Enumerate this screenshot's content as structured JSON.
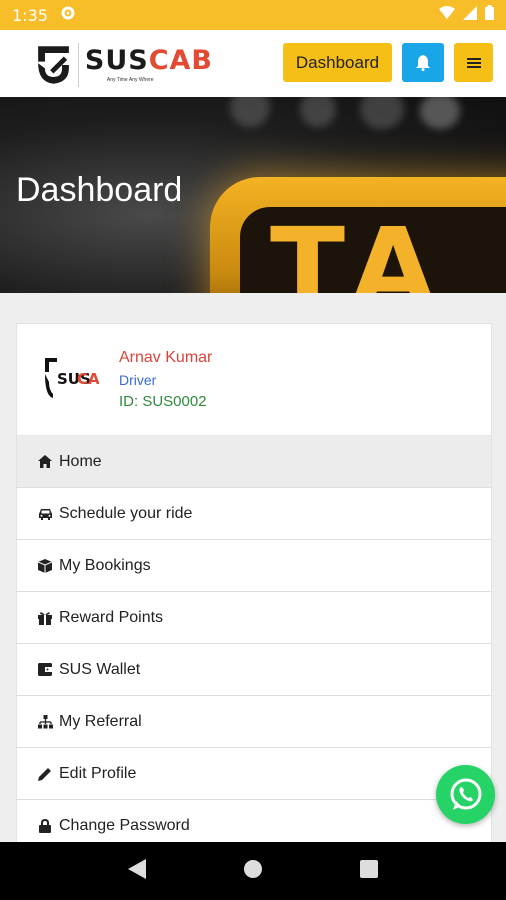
{
  "status_bar": {
    "time": "1:35",
    "icons": [
      "gear-icon",
      "wifi-icon",
      "signal-icon",
      "battery-icon"
    ]
  },
  "header": {
    "logo": {
      "sus": "SUS",
      "cab": "CAB",
      "tagline": "Any Time Any Where"
    },
    "dashboard_button": "Dashboard",
    "bell_icon": "bell-icon",
    "menu_icon": "hamburger-icon"
  },
  "hero": {
    "title": "Dashboard",
    "sign_text": "TA"
  },
  "profile": {
    "name": "Arnav Kumar",
    "role": "Driver",
    "id": "ID: SUS0002"
  },
  "menu": [
    {
      "label": "Home",
      "icon": "home-icon",
      "active": true
    },
    {
      "label": "Schedule your ride",
      "icon": "car-icon"
    },
    {
      "label": "My Bookings",
      "icon": "box-icon"
    },
    {
      "label": "Reward Points",
      "icon": "gift-icon"
    },
    {
      "label": "SUS Wallet",
      "icon": "wallet-icon"
    },
    {
      "label": "My Referral",
      "icon": "sitemap-icon"
    },
    {
      "label": "Edit Profile",
      "icon": "pencil-icon"
    },
    {
      "label": "Change Password",
      "icon": "lock-icon"
    }
  ],
  "floating": {
    "icon": "whatsapp-icon"
  },
  "nav": {
    "icons": [
      "back-icon",
      "home-nav-icon",
      "recents-icon"
    ]
  },
  "colors": {
    "status_bar": "#f7be2a",
    "accent_yellow": "#f5bf16",
    "bell_blue": "#19a6e8",
    "name_red": "#d9443a",
    "role_blue": "#3a6ad8",
    "id_green": "#2e8a3d",
    "whatsapp_green": "#25d366"
  }
}
